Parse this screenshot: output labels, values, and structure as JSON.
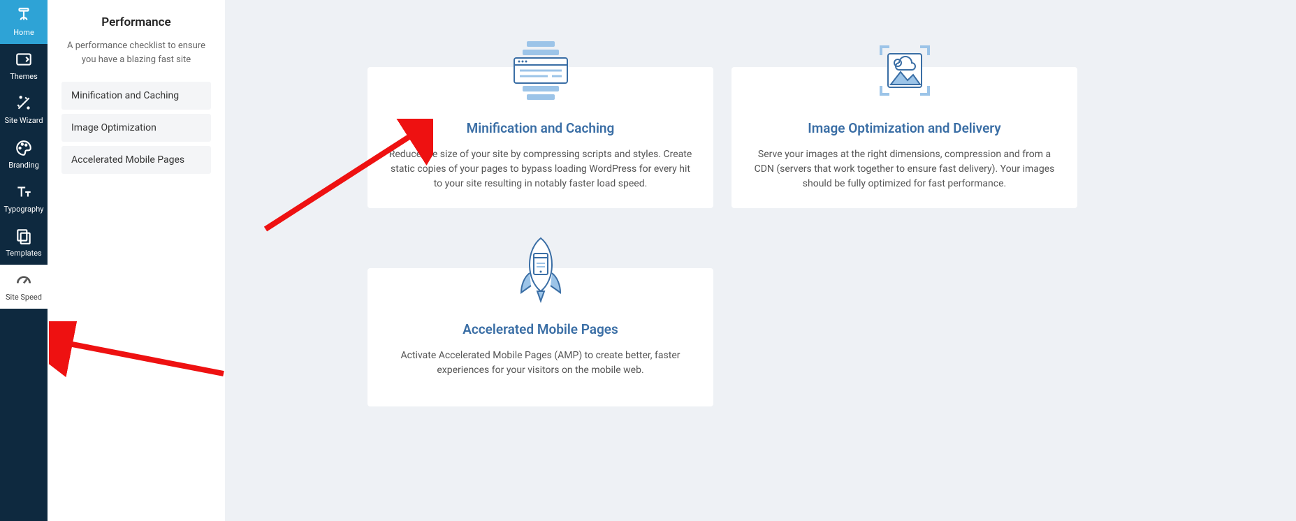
{
  "mainnav": {
    "items": [
      {
        "label": "Home"
      },
      {
        "label": "Themes"
      },
      {
        "label": "Site Wizard"
      },
      {
        "label": "Branding"
      },
      {
        "label": "Typography"
      },
      {
        "label": "Templates"
      },
      {
        "label": "Site Speed"
      }
    ]
  },
  "subpanel": {
    "title": "Performance",
    "description": "A performance checklist to ensure you have a blazing fast site",
    "items": [
      {
        "label": "Minification and Caching"
      },
      {
        "label": "Image Optimization"
      },
      {
        "label": "Accelerated Mobile Pages"
      }
    ]
  },
  "cards": [
    {
      "title": "Minification and Caching",
      "text": "Reduce the size of your site by compressing scripts and styles. Create static copies of your pages to bypass loading WordPress for every hit to your site resulting in notably faster load speed."
    },
    {
      "title": "Image Optimization and Delivery",
      "text": "Serve your images at the right dimensions, compression and from a CDN (servers that work together to ensure fast delivery). Your images should be fully optimized for fast performance."
    },
    {
      "title": "Accelerated Mobile Pages",
      "text": "Activate Accelerated Mobile Pages (AMP) to create better, faster experiences for your visitors on the mobile web."
    }
  ]
}
